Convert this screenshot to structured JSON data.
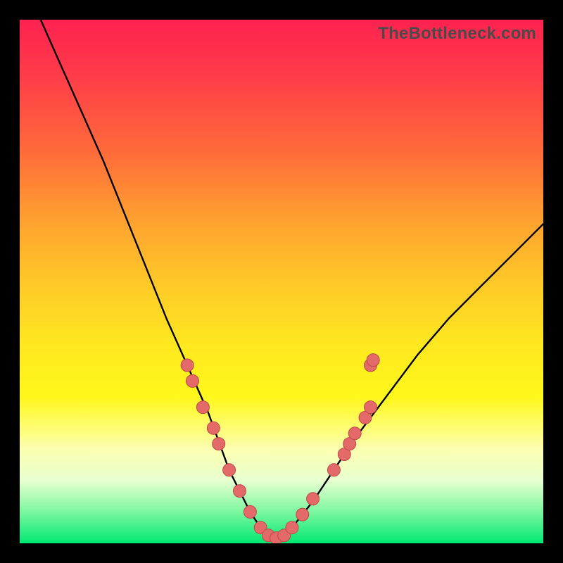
{
  "watermark": "TheBottleneck.com",
  "chart_data": {
    "type": "line",
    "title": "",
    "xlabel": "",
    "ylabel": "",
    "xlim": [
      0,
      100
    ],
    "ylim": [
      0,
      100
    ],
    "series": [
      {
        "name": "bottleneck-curve",
        "x": [
          4,
          8,
          12,
          16,
          20,
          24,
          28,
          32,
          36,
          40,
          42,
          44,
          46,
          48,
          50,
          52,
          56,
          60,
          64,
          70,
          76,
          82,
          88,
          94,
          100
        ],
        "y": [
          100,
          91,
          82,
          73,
          63,
          53,
          43,
          34,
          25,
          14,
          10,
          6,
          3,
          1,
          1,
          3,
          8,
          14,
          20,
          28,
          36,
          43,
          49,
          55,
          61
        ]
      }
    ],
    "markers": [
      {
        "x": 32,
        "y": 34
      },
      {
        "x": 33,
        "y": 31
      },
      {
        "x": 35,
        "y": 26
      },
      {
        "x": 37,
        "y": 22
      },
      {
        "x": 38,
        "y": 19
      },
      {
        "x": 40,
        "y": 14
      },
      {
        "x": 42,
        "y": 10
      },
      {
        "x": 44,
        "y": 6
      },
      {
        "x": 46,
        "y": 3
      },
      {
        "x": 47.5,
        "y": 1.5
      },
      {
        "x": 49,
        "y": 1
      },
      {
        "x": 50.5,
        "y": 1.5
      },
      {
        "x": 52,
        "y": 3
      },
      {
        "x": 54,
        "y": 5.5
      },
      {
        "x": 56,
        "y": 8.5
      },
      {
        "x": 60,
        "y": 14
      },
      {
        "x": 62,
        "y": 17
      },
      {
        "x": 63,
        "y": 19
      },
      {
        "x": 64,
        "y": 21
      },
      {
        "x": 66,
        "y": 24
      },
      {
        "x": 67,
        "y": 26
      },
      {
        "x": 67,
        "y": 34
      },
      {
        "x": 67.5,
        "y": 35
      }
    ],
    "colors": {
      "curve": "#000000",
      "marker_fill": "#e46a6a",
      "marker_stroke": "#c04848"
    }
  }
}
